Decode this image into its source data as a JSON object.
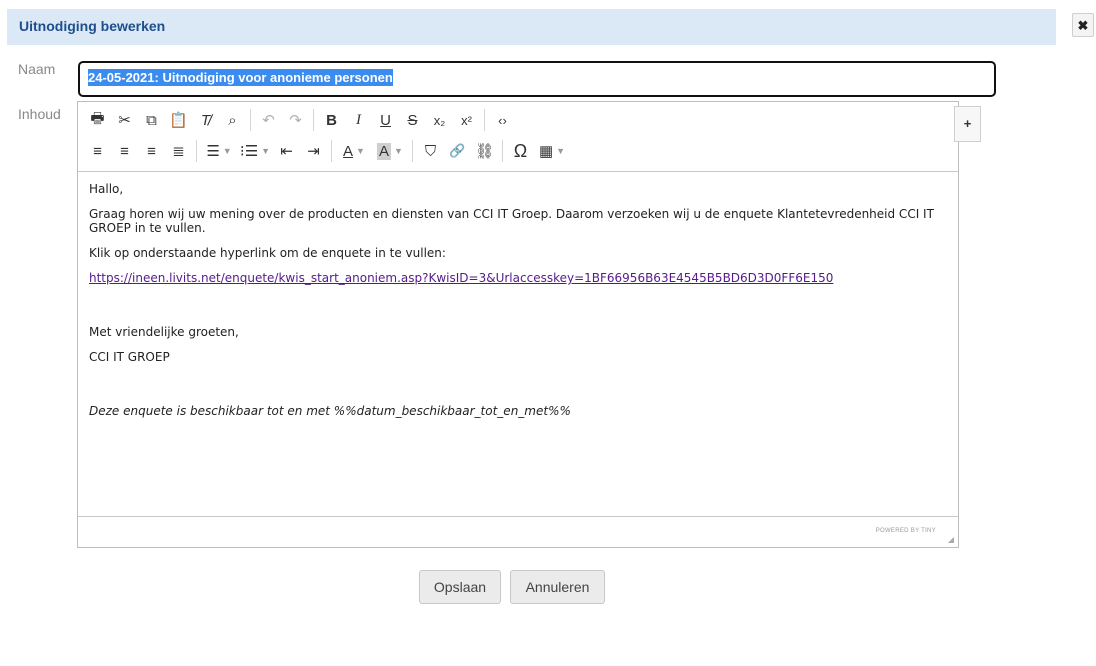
{
  "dialog": {
    "title": "Uitnodiging bewerken",
    "close_icon": "close-icon"
  },
  "form": {
    "naam_label": "Naam",
    "naam_value": "24-05-2021: Uitnodiging voor anonieme personen",
    "inhoud_label": "Inhoud"
  },
  "toolbar": {
    "row1": [
      {
        "icon": "print-icon",
        "glyph": "🖶"
      },
      {
        "icon": "cut-icon",
        "glyph": "✂"
      },
      {
        "icon": "copy-icon",
        "glyph": "⧉"
      },
      {
        "icon": "paste-icon",
        "glyph": "📋"
      },
      {
        "icon": "clear-formatting-icon",
        "glyph": "T̸"
      },
      {
        "icon": "find-replace-icon",
        "glyph": "⌕"
      },
      {
        "icon": "undo-icon",
        "glyph": "↶"
      },
      {
        "icon": "redo-icon",
        "glyph": "↷"
      },
      {
        "icon": "bold-icon",
        "glyph": "B"
      },
      {
        "icon": "italic-icon",
        "glyph": "I"
      },
      {
        "icon": "underline-icon",
        "glyph": "U"
      },
      {
        "icon": "strikethrough-icon",
        "glyph": "S"
      },
      {
        "icon": "subscript-icon",
        "glyph": "x₂"
      },
      {
        "icon": "superscript-icon",
        "glyph": "x²"
      },
      {
        "icon": "source-code-icon",
        "glyph": "‹›"
      }
    ],
    "row2": [
      {
        "icon": "align-left-icon",
        "glyph": "≡"
      },
      {
        "icon": "align-center-icon",
        "glyph": "≡"
      },
      {
        "icon": "align-right-icon",
        "glyph": "≡"
      },
      {
        "icon": "align-justify-icon",
        "glyph": "≣"
      },
      {
        "icon": "bullet-list-icon",
        "glyph": "☰"
      },
      {
        "icon": "numbered-list-icon",
        "glyph": "⁝☰"
      },
      {
        "icon": "outdent-icon",
        "glyph": "⇤"
      },
      {
        "icon": "indent-icon",
        "glyph": "⇥"
      },
      {
        "icon": "text-color-icon",
        "glyph": "A"
      },
      {
        "icon": "background-color-icon",
        "glyph": "A"
      },
      {
        "icon": "bookmark-icon",
        "glyph": "⛉"
      },
      {
        "icon": "link-icon",
        "glyph": "🔗"
      },
      {
        "icon": "unlink-icon",
        "glyph": "⛓"
      },
      {
        "icon": "special-character-icon",
        "glyph": "Ω"
      },
      {
        "icon": "table-icon",
        "glyph": "▦"
      }
    ]
  },
  "content": {
    "greeting": "Hallo,",
    "paragraph1": "Graag horen wij uw mening over de producten en diensten van CCI IT Groep. Daarom verzoeken wij u de enquete Klantetevredenheid CCI IT GROEP in te vullen.",
    "paragraph2": "Klik op onderstaande hyperlink om de enquete in te vullen:",
    "link": "https://ineen.livits.net/enquete/kwis_start_anoniem.asp?KwisID=3&Urlaccesskey=1BF66956B63E4545B5BD6D3D0FF6E150",
    "closing": "Met vriendelijke groeten,",
    "signature": "CCI IT GROEP",
    "note": "Deze enquete is beschikbaar tot en met %%datum_beschikbaar_tot_en_met%%"
  },
  "statusbar": {
    "powered_by": "POWERED BY TINY"
  },
  "side": {
    "plus_label": "+"
  },
  "buttons": {
    "save": "Opslaan",
    "cancel": "Annuleren"
  }
}
